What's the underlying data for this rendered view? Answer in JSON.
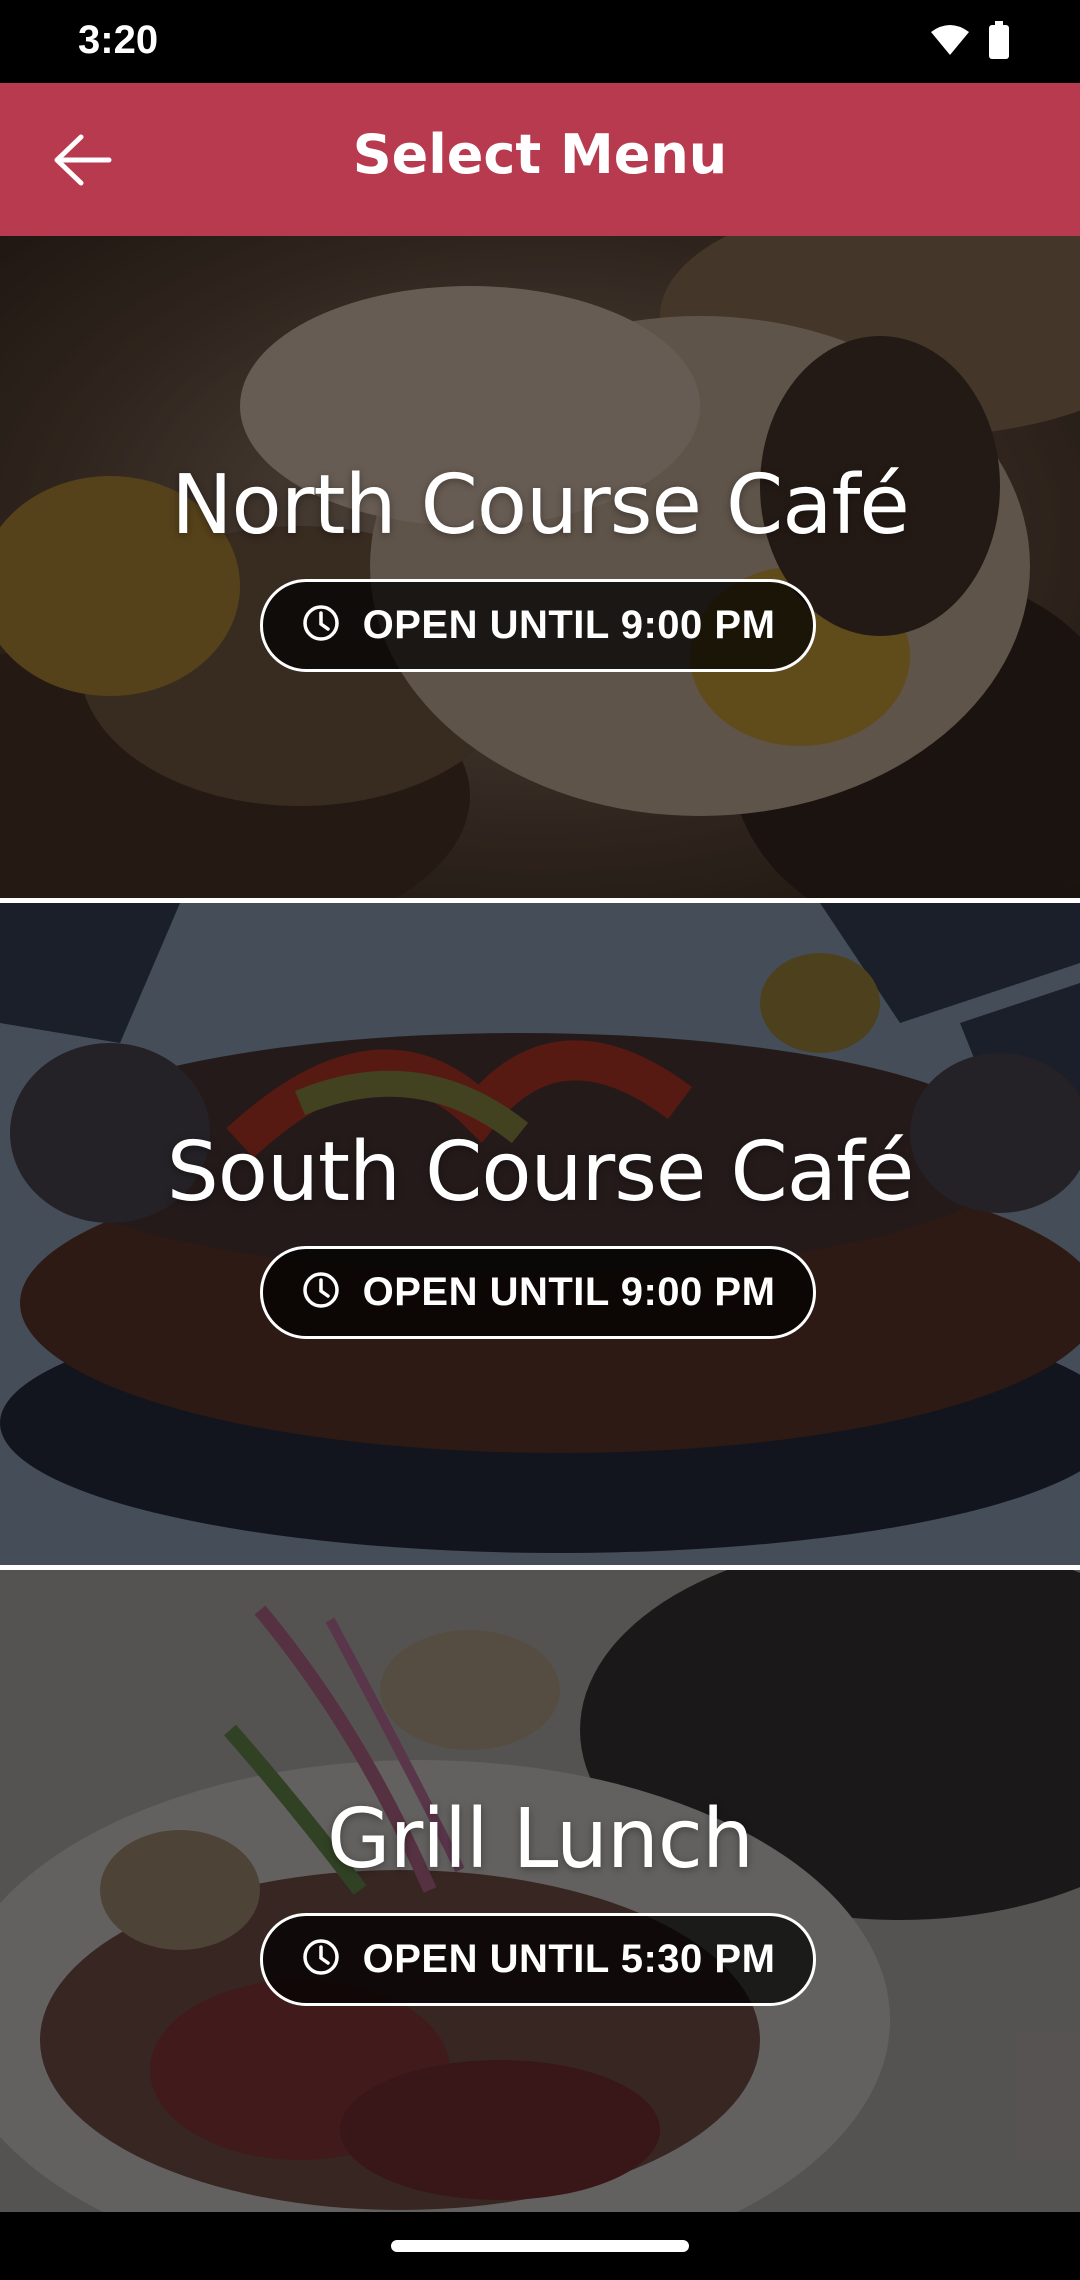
{
  "status_bar": {
    "time": "3:20",
    "icons": [
      "wifi-icon",
      "battery-icon"
    ]
  },
  "app_bar": {
    "title": "Select Menu",
    "back_icon": "arrow-left-icon",
    "color": "#b83a4f"
  },
  "menus": [
    {
      "name": "North Course Café",
      "hours": "OPEN UNTIL 9:00 PM",
      "image": "burger with cheese and sauce"
    },
    {
      "name": "South Course Café",
      "hours": "OPEN UNTIL 9:00 PM",
      "image": "sausage in bun with peppers"
    },
    {
      "name": "Grill Lunch",
      "hours": "OPEN UNTIL 5:30 PM",
      "image": "poke bowl with radish"
    }
  ],
  "hours_icon": "clock-icon"
}
